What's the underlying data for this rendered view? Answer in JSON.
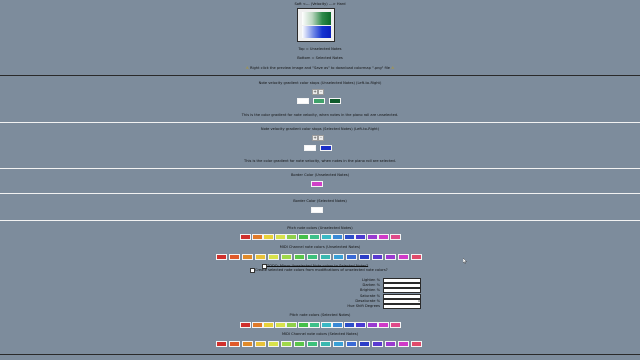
{
  "preview": {
    "caption_top": "Soft <--- (Velocity) ---> Hard",
    "caption_unselected": "Top = Unselected Notes",
    "caption_selected": "Bottom = Selected Notes",
    "hint": "Right click the preview image and \"Save as\" to download colormap \".png\" file"
  },
  "unselected_gradient": {
    "title": "Note velocity gradient color stops (Unselected Notes) (Left-to-Right)",
    "add_label": "+",
    "remove_label": "-",
    "stops": [
      "#ffffff",
      "#3fa16a",
      "#0e5a2a"
    ],
    "description": "This is the color gradient for note velocity, when notes in the piano roll are unselected."
  },
  "selected_gradient": {
    "title": "Note velocity gradient color stops (Selected Notes) (Left-to-Right)",
    "add_label": "+",
    "remove_label": "-",
    "stops": [
      "#ffffff",
      "#1a2fc8"
    ],
    "description": "This is the color gradient for note velocity, when notes in the piano roll are selected."
  },
  "border_unselected": {
    "title": "Border Color (Unselected Notes)",
    "color": "#d040c8"
  },
  "border_selected": {
    "title": "Border Color (Selected Notes)",
    "color": "#ffffff"
  },
  "pitch_unselected": {
    "title": "Pitch note colors (Unselected Notes)",
    "colors": [
      "#d0302c",
      "#e07a2a",
      "#e8d23a",
      "#d8e24c",
      "#8fd04a",
      "#45c04a",
      "#3cc08a",
      "#3ab8c4",
      "#3a8ad6",
      "#2c4ec8",
      "#4a3ad0",
      "#9a3ad0",
      "#d03ac8",
      "#e04a8a"
    ]
  },
  "midi_unselected": {
    "title": "MIDI Channel note colors (Unselected Notes)",
    "colors": [
      "#d0302c",
      "#e05a2a",
      "#e08a2a",
      "#e8c23a",
      "#d8e24c",
      "#a0d84a",
      "#5ac44a",
      "#3cc07a",
      "#3ab8b0",
      "#3aa0d6",
      "#3a6ad6",
      "#2c3ec8",
      "#5a3ad0",
      "#9a3ad0",
      "#d03ac8",
      "#e04a6a"
    ]
  },
  "options": {
    "mirror_label": "TODO: Mirror Unselected Note colors to Selected Notes?",
    "modify_label": "Create selected note colors from modifications of unselected note colors?"
  },
  "modifiers": [
    {
      "label": "Lighten %",
      "value": ""
    },
    {
      "label": "Darken %",
      "value": ""
    },
    {
      "label": "Brighten %",
      "value": ""
    },
    {
      "label": "Saturate %",
      "value": ""
    },
    {
      "label": "Desaturate %",
      "value": "0"
    },
    {
      "label": "Hue Shift Degrees",
      "value": ""
    }
  ],
  "pitch_selected": {
    "title": "Pitch note colors (Selected Notes)",
    "colors": [
      "#d0302c",
      "#e07a2a",
      "#e8d23a",
      "#d8e24c",
      "#8fd04a",
      "#45c04a",
      "#3cc08a",
      "#3ab8c4",
      "#3a8ad6",
      "#2c4ec8",
      "#4a3ad0",
      "#9a3ad0",
      "#d03ac8",
      "#e04a8a"
    ]
  },
  "midi_selected": {
    "title": "MIDI Channel note colors (Selected Notes)",
    "colors": [
      "#d0302c",
      "#e05a2a",
      "#e08a2a",
      "#e8c23a",
      "#d8e24c",
      "#a0d84a",
      "#5ac44a",
      "#3cc07a",
      "#3ab8b0",
      "#3aa0d6",
      "#3a6ad6",
      "#2c3ec8",
      "#5a3ad0",
      "#9a3ad0",
      "#d03ac8",
      "#e04a6a"
    ]
  }
}
